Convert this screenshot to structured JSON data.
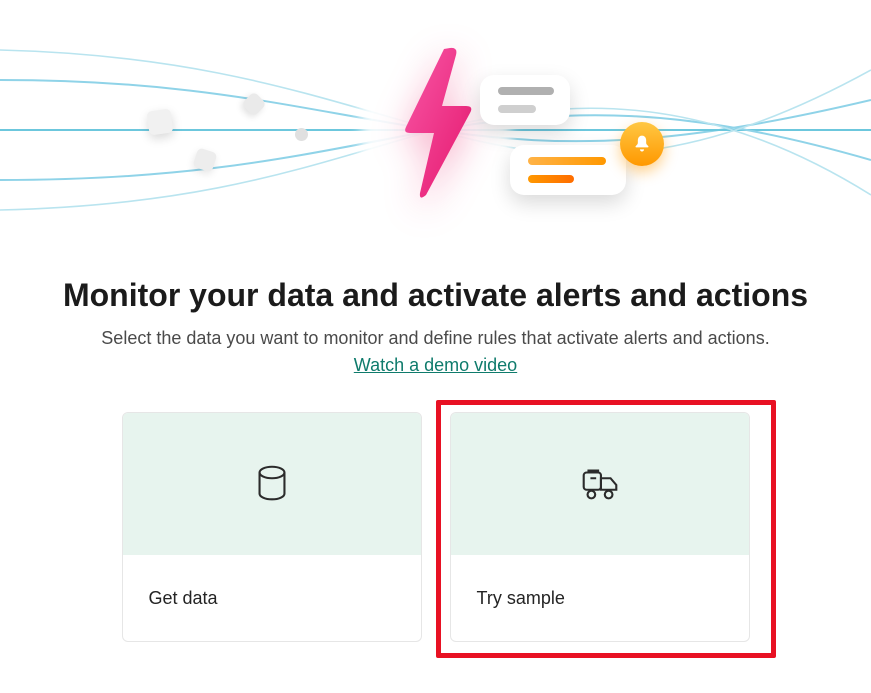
{
  "hero": {
    "illustration_alt": "Data activation illustration with lightning bolt and notification cards"
  },
  "heading": "Monitor your data and activate alerts and actions",
  "subtext": "Select the data you want to monitor and define rules that activate alerts and actions.",
  "demo_link_label": "Watch a demo video",
  "cards": {
    "get_data": {
      "label": "Get data"
    },
    "try_sample": {
      "label": "Try sample"
    }
  },
  "icons": {
    "database": "database-icon",
    "truck": "delivery-truck-icon",
    "bell": "bell-icon",
    "bolt": "lightning-bolt-icon"
  },
  "colors": {
    "accent_pink_start": "#f857a6",
    "accent_pink_end": "#e5186e",
    "link": "#0f7b6c",
    "card_tint": "#e7f4ee",
    "highlight": "#e81123",
    "orange_start": "#ffb347",
    "orange_end": "#ff6d00"
  }
}
